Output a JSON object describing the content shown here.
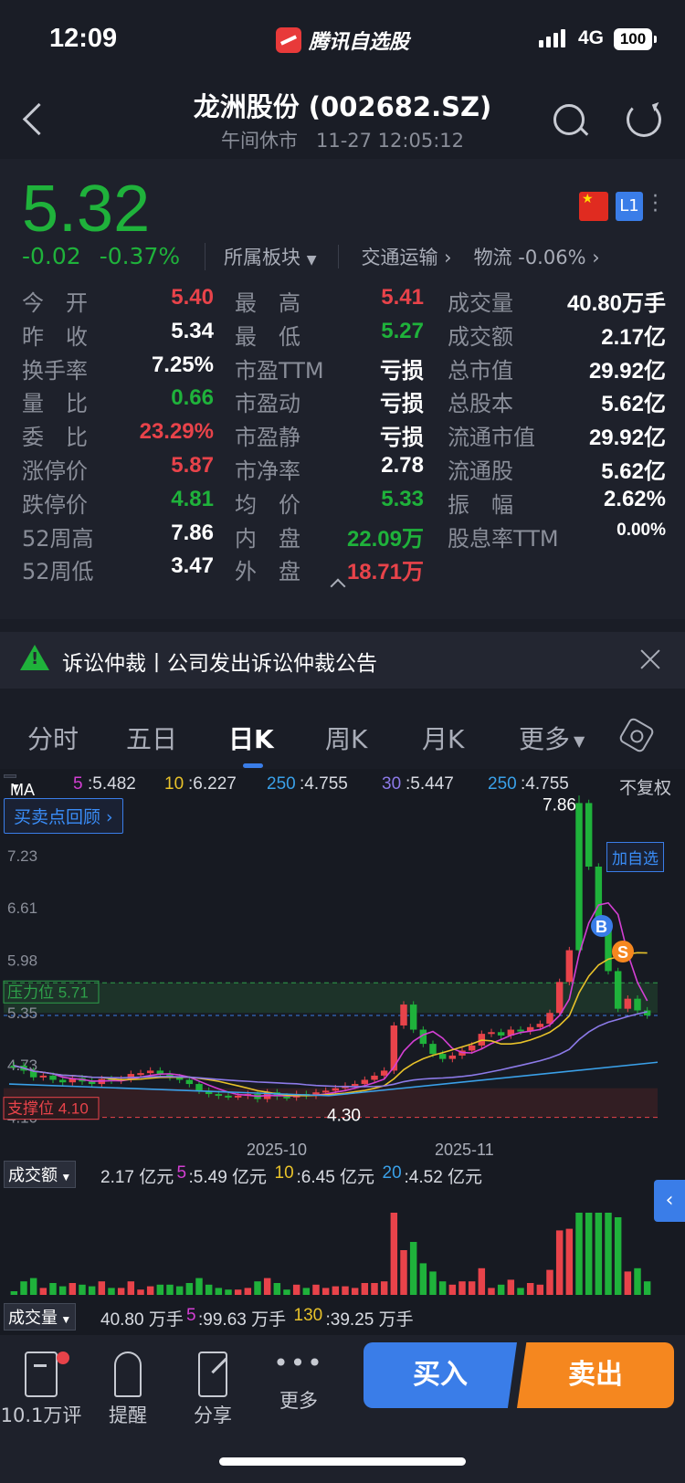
{
  "status": {
    "time": "12:09",
    "app": "腾讯自选股",
    "network": "4G",
    "battery": "100"
  },
  "header": {
    "title": "龙洲股份 (002682.SZ)",
    "market_state": "午间休市",
    "datetime": "11-27 12:05:12"
  },
  "quote": {
    "price": "5.32",
    "change": "-0.02",
    "change_pct": "-0.37%",
    "plate_label": "所属板块",
    "plate_name": "交通运输",
    "plate2": "物流 -0.06%",
    "badge": "L1"
  },
  "stats": {
    "rows": [
      [
        {
          "l": "今　开",
          "v": "5.40",
          "c": "red"
        },
        {
          "l": "最　高",
          "v": "5.41",
          "c": "red"
        },
        {
          "l": "成交量",
          "v": "40.80万手",
          "c": ""
        }
      ],
      [
        {
          "l": "昨　收",
          "v": "5.34",
          "c": ""
        },
        {
          "l": "最　低",
          "v": "5.27",
          "c": "grn"
        },
        {
          "l": "成交额",
          "v": "2.17亿",
          "c": ""
        }
      ],
      [
        {
          "l": "换手率",
          "v": "7.25%",
          "c": ""
        },
        {
          "l": "市盈TTM",
          "v": "亏损",
          "c": ""
        },
        {
          "l": "总市值",
          "v": "29.92亿",
          "c": ""
        }
      ],
      [
        {
          "l": "量　比",
          "v": "0.66",
          "c": "grn"
        },
        {
          "l": "市盈动",
          "v": "亏损",
          "c": ""
        },
        {
          "l": "总股本",
          "v": "5.62亿",
          "c": ""
        }
      ],
      [
        {
          "l": "委　比",
          "v": "23.29%",
          "c": "red"
        },
        {
          "l": "市盈静",
          "v": "亏损",
          "c": ""
        },
        {
          "l": "流通市值",
          "v": "29.92亿",
          "c": ""
        }
      ],
      [
        {
          "l": "涨停价",
          "v": "5.87",
          "c": "red"
        },
        {
          "l": "市净率",
          "v": "2.78",
          "c": ""
        },
        {
          "l": "流通股",
          "v": "5.62亿",
          "c": ""
        }
      ],
      [
        {
          "l": "跌停价",
          "v": "4.81",
          "c": "grn"
        },
        {
          "l": "均　价",
          "v": "5.33",
          "c": "grn"
        },
        {
          "l": "振　幅",
          "v": "2.62%",
          "c": ""
        }
      ],
      [
        {
          "l": "52周高",
          "v": "7.86",
          "c": ""
        },
        {
          "l": "内　盘",
          "v": "22.09万",
          "c": "grn"
        },
        {
          "l": "股息率TTM",
          "v": "0.00%",
          "c": ""
        }
      ],
      [
        {
          "l": "52周低",
          "v": "3.47",
          "c": ""
        },
        {
          "l": "外　盘",
          "v": "18.71万",
          "c": "red"
        },
        {
          "l": "",
          "v": "",
          "c": ""
        }
      ]
    ]
  },
  "notice": {
    "text": "诉讼仲裁丨公司发出诉讼仲裁公告"
  },
  "tabs": [
    {
      "label": "分时",
      "active": false
    },
    {
      "label": "五日",
      "active": false
    },
    {
      "label": "日K",
      "active": true
    },
    {
      "label": "周K",
      "active": false
    },
    {
      "label": "月K",
      "active": false
    },
    {
      "label": "更多",
      "active": false
    }
  ],
  "chart": {
    "ma_button": "MA",
    "ma": [
      {
        "k": "5",
        "v": ":5.482",
        "color": "#d33fd3"
      },
      {
        "k": "10",
        "v": ":6.227",
        "color": "#e8c22a"
      },
      {
        "k": "250",
        "v": ":4.755",
        "color": "#3aa0e8"
      },
      {
        "k": "30",
        "v": ":5.447",
        "color": "#8c7ae8"
      },
      {
        "k": "250",
        "v": ":4.755",
        "color": "#3aa0e8"
      }
    ],
    "adjust": "不复权",
    "review": "买卖点回顾",
    "add_fav": "加自选",
    "y_ticks": [
      "7.23",
      "6.61",
      "5.98",
      "5.35",
      "4.73",
      "4.10"
    ],
    "high_label": "7.86",
    "low_label": "4.30",
    "resistance": "压力位 5.71",
    "support": "支撑位 4.10",
    "x_ticks": [
      "2025-10",
      "2025-11"
    ],
    "buy_mark": "B",
    "sell_mark": "S",
    "amount_btn": "成交额",
    "amount": [
      {
        "t": "2.17 亿元",
        "color": "#d8dbe2"
      },
      {
        "t": "5",
        "color": "#d33fd3"
      },
      {
        "t": ":5.49 亿元",
        "color": "#d8dbe2"
      },
      {
        "t": "10",
        "color": "#e8c22a"
      },
      {
        "t": ":6.45 亿元",
        "color": "#d8dbe2"
      },
      {
        "t": "20",
        "color": "#3aa0e8"
      },
      {
        "t": ":4.52 亿元",
        "color": "#d8dbe2"
      }
    ],
    "volume_btn": "成交量",
    "volume": [
      {
        "t": "40.80 万手",
        "color": "#d8dbe2"
      },
      {
        "t": "5",
        "color": "#d33fd3"
      },
      {
        "t": ":99.63 万手",
        "color": "#d8dbe2"
      },
      {
        "t": "130",
        "color": "#e8c22a"
      },
      {
        "t": ":39.25 万手",
        "color": "#d8dbe2"
      }
    ],
    "chart_data": {
      "type": "candlestick",
      "close": [
        4.72,
        4.66,
        4.58,
        4.6,
        4.55,
        4.52,
        4.57,
        4.53,
        4.5,
        4.56,
        4.54,
        4.56,
        4.62,
        4.63,
        4.66,
        4.62,
        4.58,
        4.55,
        4.5,
        4.42,
        4.38,
        4.36,
        4.35,
        4.36,
        4.38,
        4.32,
        4.4,
        4.35,
        4.34,
        4.38,
        4.36,
        4.4,
        4.42,
        4.45,
        4.48,
        4.5,
        4.55,
        4.6,
        4.66,
        5.2,
        5.45,
        5.15,
        4.98,
        4.86,
        4.8,
        4.84,
        4.9,
        4.96,
        5.1,
        5.12,
        5.08,
        5.15,
        5.13,
        5.18,
        5.22,
        5.35,
        5.72,
        6.1,
        7.86,
        7.1,
        6.42,
        5.85,
        5.4,
        5.52,
        5.38,
        5.32
      ],
      "up": [
        false,
        false,
        false,
        true,
        false,
        false,
        true,
        false,
        false,
        true,
        false,
        true,
        true,
        true,
        true,
        false,
        false,
        false,
        false,
        false,
        false,
        false,
        false,
        true,
        true,
        false,
        true,
        false,
        false,
        true,
        false,
        true,
        true,
        true,
        true,
        true,
        true,
        true,
        true,
        true,
        true,
        false,
        false,
        false,
        false,
        true,
        true,
        true,
        true,
        true,
        false,
        true,
        false,
        true,
        true,
        true,
        true,
        true,
        false,
        false,
        false,
        false,
        false,
        true,
        false,
        false
      ]
    },
    "colors": {
      "up": "#e8434a",
      "down": "#1fb23b"
    }
  },
  "bottom": {
    "comments": "10.1万评",
    "alert": "提醒",
    "share": "分享",
    "more": "更多",
    "buy": "买入",
    "sell": "卖出"
  }
}
